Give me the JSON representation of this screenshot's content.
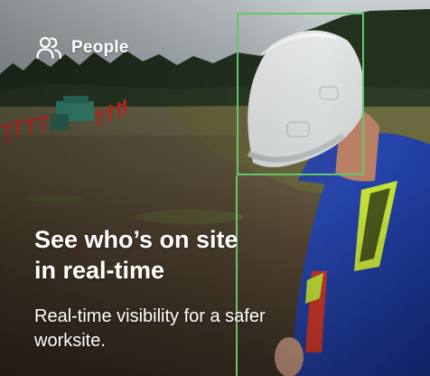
{
  "badge": {
    "icon": "people-icon",
    "label": "People"
  },
  "headline": {
    "line1": "See who’s on site",
    "line2": "in real-time"
  },
  "subhead": {
    "line1": "Real-time visibility for a safer",
    "line2": "worksite."
  },
  "colors": {
    "detection_box": "#66c56a",
    "hard_hat": "#e8eaea",
    "jacket": "#1f3fa8",
    "reflective_stripe": "#c8e63a"
  }
}
